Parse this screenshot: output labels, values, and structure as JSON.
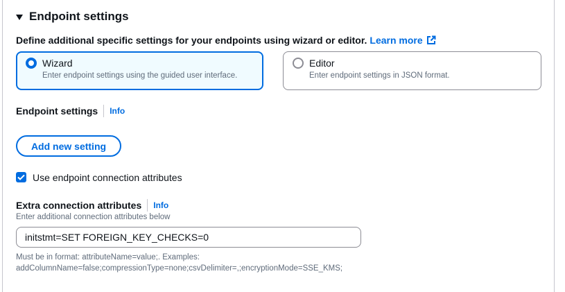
{
  "section": {
    "title": "Endpoint settings",
    "description": "Define additional specific settings for your endpoints using wizard or editor.",
    "learn_more": "Learn more",
    "accent_color": "#006ce0"
  },
  "mode_tiles": [
    {
      "label": "Wizard",
      "description": "Enter endpoint settings using the guided user interface.",
      "selected": true
    },
    {
      "label": "Editor",
      "description": "Enter endpoint settings in JSON format.",
      "selected": false
    }
  ],
  "endpoint_settings": {
    "label": "Endpoint settings",
    "info": "Info",
    "add_button": "Add new setting"
  },
  "connection_attributes_checkbox": {
    "label": "Use endpoint connection attributes",
    "checked": true
  },
  "extra_attributes": {
    "label": "Extra connection attributes",
    "info": "Info",
    "hint": "Enter additional connection attributes below",
    "value": "initstmt=SET FOREIGN_KEY_CHECKS=0",
    "constraint_line1": "Must be in format: attributeName=value;. Examples:",
    "constraint_line2": "addColumnName=false;compressionType=none;csvDelimiter=,;encryptionMode=SSE_KMS;"
  },
  "icons": {
    "expand": "caret-down-icon",
    "external_link": "external-link-icon",
    "check": "checkmark-icon"
  }
}
